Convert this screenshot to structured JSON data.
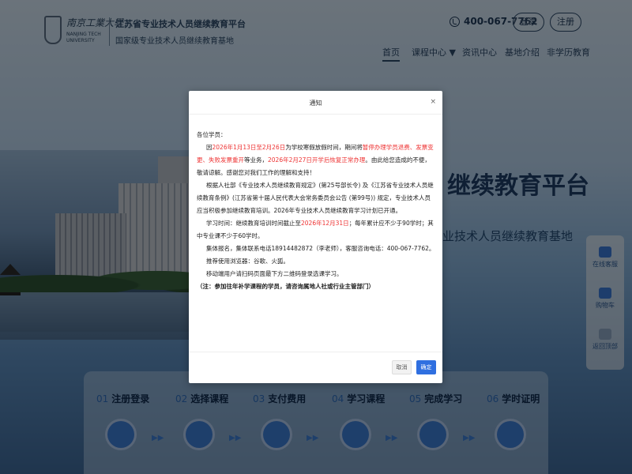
{
  "header": {
    "logo_cn": "南京工業大學",
    "logo_en": "NANJING TECH UNIVERSITY",
    "site_title": "江苏省专业技术人员继续教育平台",
    "site_subtitle": "国家级专业技术人员继续教育基地",
    "phone": "400-067-7762",
    "login_label": "登录",
    "register_label": "注册"
  },
  "nav": {
    "items": [
      {
        "label": "首页"
      },
      {
        "label": "课程中心 ▼"
      },
      {
        "label": "资讯中心"
      },
      {
        "label": "基地介绍"
      },
      {
        "label": "非学历教育"
      }
    ]
  },
  "hero": {
    "title": "继续教育平台",
    "subtitle": "业技术人员继续教育基地"
  },
  "side_panel": {
    "items": [
      {
        "label": "在线客服"
      },
      {
        "label": "购物车"
      },
      {
        "label": "返回顶部"
      }
    ]
  },
  "steps": [
    {
      "num": "01",
      "label": "注册登录"
    },
    {
      "num": "02",
      "label": "选择课程"
    },
    {
      "num": "03",
      "label": "支付费用"
    },
    {
      "num": "04",
      "label": "学习课程"
    },
    {
      "num": "05",
      "label": "完成学习"
    },
    {
      "num": "06",
      "label": "学时证明"
    }
  ],
  "modal": {
    "title": "通知",
    "close": "×",
    "greeting": "各位学员：",
    "p1_a": "因",
    "p1_red1": "2026年1月13日至2月26日",
    "p1_b": "为学校寒假放假时间，期间将",
    "p1_red2": "暂停办理学员退费、发票变更、失败发票重开",
    "p1_c": "等业务，",
    "p1_red3": "2026年2月27日开学后恢复正常办理",
    "p1_d": "。由此给您造成的不便，敬请谅解。感谢您对我们工作的理解和支持！",
    "p2": "根据人社部《专业技术人员继续教育规定》(第25号部长令) 及《江苏省专业技术人员继续教育条例》(江苏省第十届人民代表大会常务委员会公告 (第99号)) 规定，专业技术人员应当积极参加继续教育培训。2026年专业技术人员继续教育学习计划已开通。",
    "p3_a": "学习时间：继续教育培训时间截止至",
    "p3_red": "2026年12月31日",
    "p3_b": "；每年累计应不少于90学时；其中专业课不少于60学时。",
    "p4": "集体报名，集体联系电话18914482872（李老师），客服咨询电话：400-067-7762。",
    "p5": "推荐使用浏览器：谷歌、火狐。",
    "p6": "移动端用户请扫码页面最下方二维码登录选课学习。",
    "p7": "（注：参加往年补学课程的学员，请咨询属地人社或行业主管部门）",
    "cancel_label": "取消",
    "ok_label": "确定"
  }
}
